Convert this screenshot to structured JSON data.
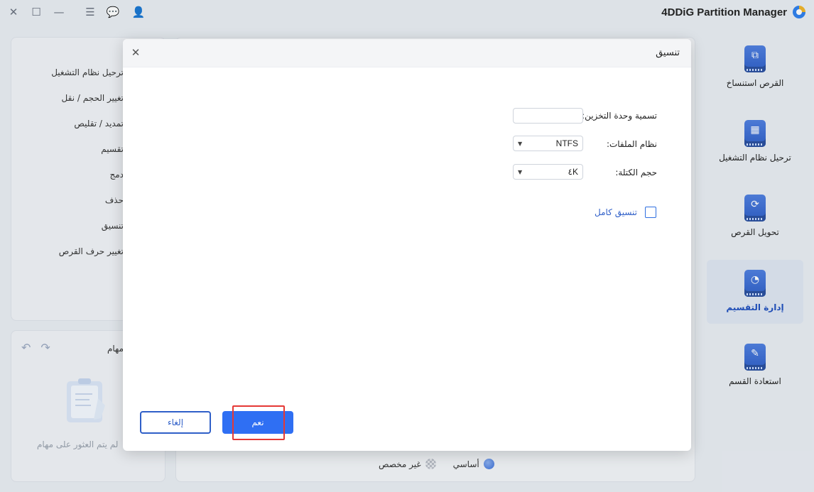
{
  "app": {
    "name": "4DDiG Partition Manager",
    "window_controls": {
      "close": "✕",
      "maximize": "☐",
      "minimize": "—",
      "menu": "☰",
      "feedback": "💬",
      "account": "👤"
    }
  },
  "ops_panel": {
    "items": [
      "ترحيل نظام التشغيل",
      "تغيير الحجم / نقل",
      "تمديد / تقليص",
      "تقسيم",
      "دمج",
      "حذف",
      "تنسيق",
      "تغيير حرف القرص"
    ]
  },
  "tasks_panel": {
    "title": "مهام",
    "empty_text": "لم يتم العثور على مهام"
  },
  "legend": {
    "basic": "أساسي",
    "unallocated": "غير مخصص"
  },
  "nav": {
    "items": [
      {
        "label": "القرص استنساخ",
        "icon": "disk-clone-icon",
        "active": false
      },
      {
        "label": "ترحيل نظام التشغيل",
        "icon": "os-migrate-icon",
        "active": false
      },
      {
        "label": "تحويل القرص",
        "icon": "disk-convert-icon",
        "active": false
      },
      {
        "label": "إدارة التقسيم",
        "icon": "partition-manage-icon",
        "active": true
      },
      {
        "label": "استعادة القسم",
        "icon": "partition-recovery-icon",
        "active": false
      }
    ]
  },
  "modal": {
    "title": "تنسيق",
    "volume_label_label": "تسمية وحدة التخزين:",
    "volume_label_value": "",
    "file_system_label": "نظام الملفات:",
    "file_system_value": "NTFS",
    "cluster_size_label": "حجم الكتلة:",
    "cluster_size_value": "٤K",
    "full_format_label": "تنسيق كامل",
    "full_format_checked": false,
    "ok_label": "نعم",
    "cancel_label": "إلغاء"
  },
  "colors": {
    "accent": "#2f6ff3",
    "highlight": "#e53935",
    "nav_active_bg": "#dfe6f2"
  }
}
